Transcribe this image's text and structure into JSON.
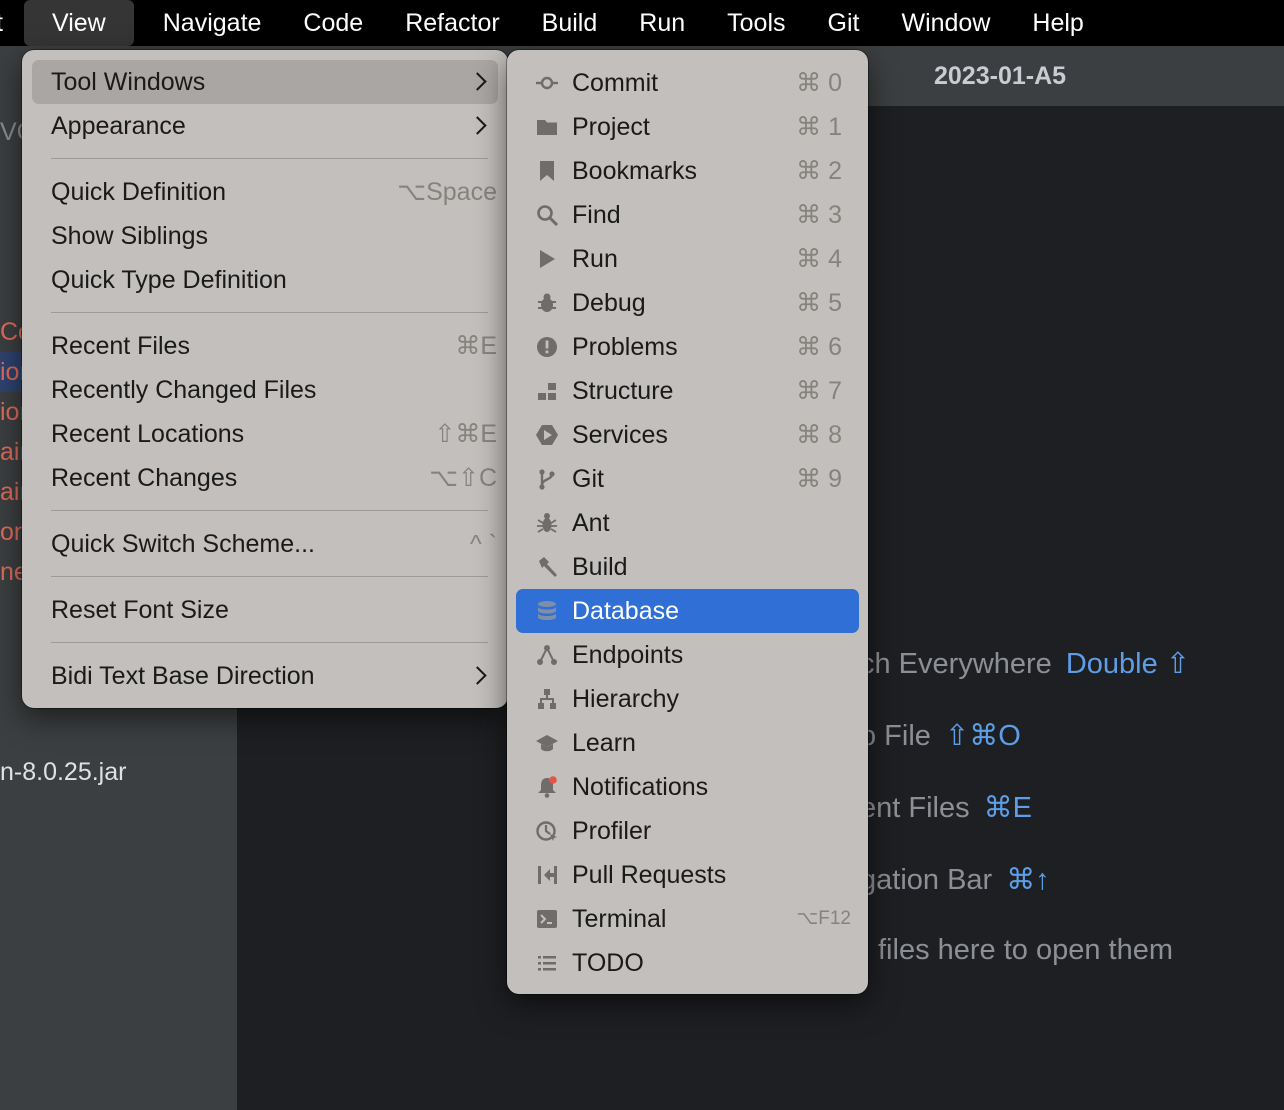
{
  "menubar": {
    "items": [
      {
        "label": "t"
      },
      {
        "label": "View"
      },
      {
        "label": "Navigate"
      },
      {
        "label": "Code"
      },
      {
        "label": "Refactor"
      },
      {
        "label": "Build"
      },
      {
        "label": "Run"
      },
      {
        "label": "Tools"
      },
      {
        "label": "Git"
      },
      {
        "label": "Window"
      },
      {
        "label": "Help"
      }
    ]
  },
  "window": {
    "title": "2023-01-A5"
  },
  "sidebar": {
    "fragments": [
      "VC",
      "Co",
      "ion",
      "ion",
      "ain",
      "ain",
      "on",
      "ne",
      "n-8.0.25.jar"
    ]
  },
  "editor": {
    "hints": [
      {
        "text": "ch Everywhere",
        "key": "Double ⇧"
      },
      {
        "text": "o File",
        "key": "⇧⌘O"
      },
      {
        "text": "ent Files",
        "key": "⌘E"
      },
      {
        "text": "gation Bar",
        "key": "⌘↑"
      },
      {
        "text": "files here to open them",
        "key": ""
      }
    ]
  },
  "view_menu": {
    "items": [
      {
        "label": "Tool Windows",
        "shortcut": "",
        "submenu": true
      },
      {
        "label": "Appearance",
        "shortcut": "",
        "submenu": true
      },
      {
        "label": "Quick Definition",
        "shortcut": "⌥Space"
      },
      {
        "label": "Show Siblings",
        "shortcut": ""
      },
      {
        "label": "Quick Type Definition",
        "shortcut": ""
      },
      {
        "label": "Recent Files",
        "shortcut": "⌘E"
      },
      {
        "label": "Recently Changed Files",
        "shortcut": ""
      },
      {
        "label": "Recent Locations",
        "shortcut": "⇧⌘E"
      },
      {
        "label": "Recent Changes",
        "shortcut": "⌥⇧C"
      },
      {
        "label": "Quick Switch Scheme...",
        "shortcut": "^ `"
      },
      {
        "label": "Reset Font Size",
        "shortcut": ""
      },
      {
        "label": "Bidi Text Base Direction",
        "shortcut": "",
        "submenu": true
      }
    ]
  },
  "tool_windows_menu": {
    "selected": "Database",
    "items": [
      {
        "label": "Commit",
        "shortcut": "⌘ 0",
        "icon": "commit-icon"
      },
      {
        "label": "Project",
        "shortcut": "⌘ 1",
        "icon": "folder-icon"
      },
      {
        "label": "Bookmarks",
        "shortcut": "⌘ 2",
        "icon": "bookmark-icon"
      },
      {
        "label": "Find",
        "shortcut": "⌘ 3",
        "icon": "search-icon"
      },
      {
        "label": "Run",
        "shortcut": "⌘ 4",
        "icon": "play-icon"
      },
      {
        "label": "Debug",
        "shortcut": "⌘ 5",
        "icon": "bug-icon"
      },
      {
        "label": "Problems",
        "shortcut": "⌘ 6",
        "icon": "problems-icon"
      },
      {
        "label": "Structure",
        "shortcut": "⌘ 7",
        "icon": "structure-icon"
      },
      {
        "label": "Services",
        "shortcut": "⌘ 8",
        "icon": "services-icon"
      },
      {
        "label": "Git",
        "shortcut": "⌘ 9",
        "icon": "git-branch-icon"
      },
      {
        "label": "Ant",
        "shortcut": "",
        "icon": "ant-icon"
      },
      {
        "label": "Build",
        "shortcut": "",
        "icon": "hammer-icon"
      },
      {
        "label": "Database",
        "shortcut": "",
        "icon": "database-icon"
      },
      {
        "label": "Endpoints",
        "shortcut": "",
        "icon": "endpoints-icon"
      },
      {
        "label": "Hierarchy",
        "shortcut": "",
        "icon": "hierarchy-icon"
      },
      {
        "label": "Learn",
        "shortcut": "",
        "icon": "graduation-cap-icon"
      },
      {
        "label": "Notifications",
        "shortcut": "",
        "icon": "bell-icon"
      },
      {
        "label": "Profiler",
        "shortcut": "",
        "icon": "profiler-icon"
      },
      {
        "label": "Pull Requests",
        "shortcut": "",
        "icon": "pull-request-icon"
      },
      {
        "label": "Terminal",
        "shortcut": "⌥F12",
        "icon": "terminal-icon"
      },
      {
        "label": "TODO",
        "shortcut": "",
        "icon": "list-icon"
      }
    ]
  },
  "colors": {
    "selection": "#2f6fd6",
    "menu_bg": "#c2bfbc",
    "link_key": "#5c9ee8",
    "sidebar_error": "#e06c5b"
  }
}
